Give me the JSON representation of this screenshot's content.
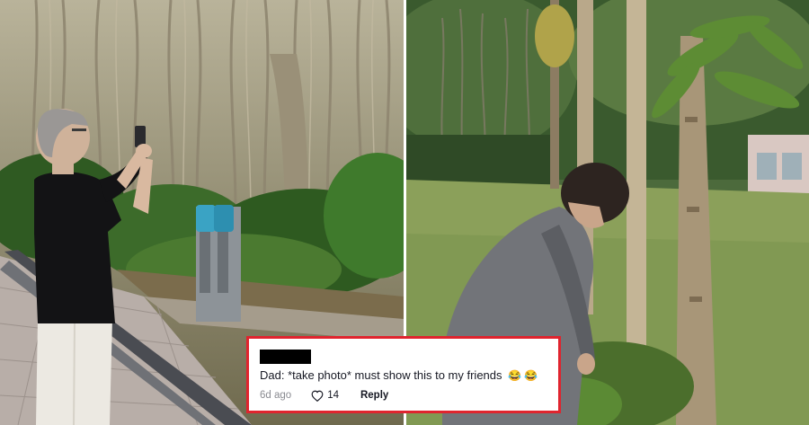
{
  "comment": {
    "text": "Dad: *take photo* must show this to my friends",
    "emojis": [
      "😂",
      "😂"
    ],
    "time": "6d ago",
    "likes": "14",
    "reply_label": "Reply"
  },
  "colors": {
    "highlight_border": "#e0242e",
    "redaction": "#000000"
  },
  "icons": {
    "like": "heart-outline-icon",
    "emoji": "face-with-tears-of-joy"
  }
}
